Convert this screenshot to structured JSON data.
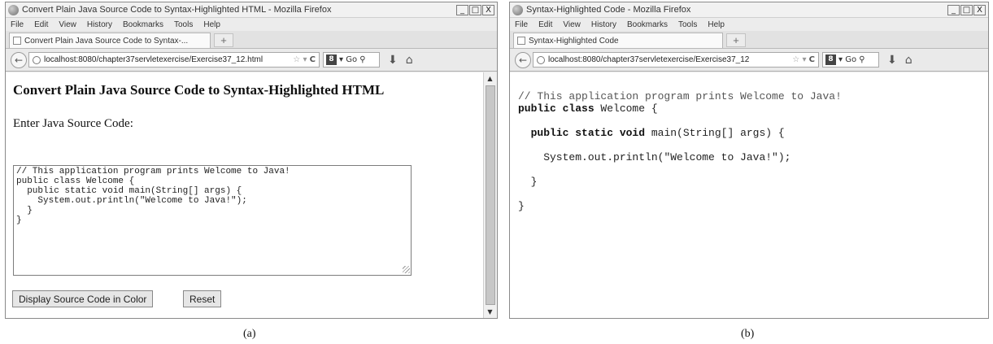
{
  "windows": {
    "a": {
      "title": "Convert Plain Java Source Code to Syntax-Highlighted HTML - Mozilla Firefox",
      "menu": [
        "File",
        "Edit",
        "View",
        "History",
        "Bookmarks",
        "Tools",
        "Help"
      ],
      "tab_label": "Convert Plain Java Source Code to Syntax-...",
      "url": "localhost:8080/chapter37servletexercise/Exercise37_12.html",
      "search_placeholder": "Go",
      "page_heading": "Convert Plain Java Source Code to Syntax-Highlighted HTML",
      "source_label": "Enter Java Source Code:",
      "source_code": "// This application program prints Welcome to Java!\npublic class Welcome {\n  public static void main(String[] args) {\n    System.out.println(\"Welcome to Java!\");\n  }\n}",
      "display_button": "Display Source Code in Color",
      "reset_button": "Reset"
    },
    "b": {
      "title": "Syntax-Highlighted Code - Mozilla Firefox",
      "menu": [
        "File",
        "Edit",
        "View",
        "History",
        "Bookmarks",
        "Tools",
        "Help"
      ],
      "tab_label": "Syntax-Highlighted Code",
      "url": "localhost:8080/chapter37servletexercise/Exercise37_12",
      "search_placeholder": "Go",
      "code_lines": [
        [
          {
            "t": "// This application program prints Welcome to Java!",
            "k": "comment"
          }
        ],
        [
          {
            "t": "public class",
            "k": "kw"
          },
          {
            "t": " Welcome {",
            "k": "plain"
          }
        ],
        [],
        [
          {
            "t": "  ",
            "k": "plain"
          },
          {
            "t": "public static void",
            "k": "kw"
          },
          {
            "t": " main(String[] args) {",
            "k": "plain"
          }
        ],
        [],
        [
          {
            "t": "    System.out.println(",
            "k": "plain"
          },
          {
            "t": "\"Welcome to Java!\"",
            "k": "str"
          },
          {
            "t": ");",
            "k": "plain"
          }
        ],
        [],
        [
          {
            "t": "  }",
            "k": "plain"
          }
        ],
        [],
        [
          {
            "t": "}",
            "k": "plain"
          }
        ]
      ]
    }
  },
  "captions": {
    "a": "(a)",
    "b": "(b)"
  },
  "window_controls": {
    "minimize": "_",
    "maximize": "□",
    "close": "X"
  },
  "icons": {
    "back": "arrow-left-icon",
    "bookmark_star": "star-icon",
    "download": "download-icon",
    "home": "home-icon"
  }
}
